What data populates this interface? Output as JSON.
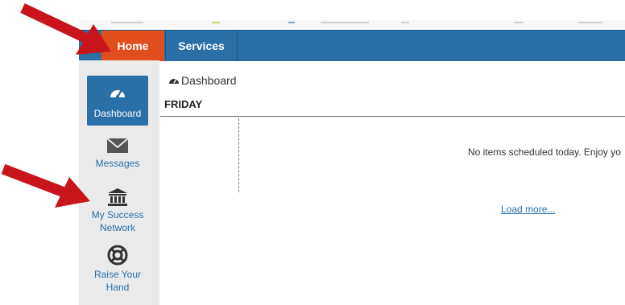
{
  "nav": {
    "home_label": "Home",
    "services_label": "Services"
  },
  "sidebar": {
    "items": [
      {
        "label": "Dashboard",
        "icon": "dashboard-icon",
        "active": true
      },
      {
        "label": "Messages",
        "icon": "envelope-icon"
      },
      {
        "label": "My Success Network",
        "icon": "bank-icon"
      },
      {
        "label": "Raise Your Hand",
        "icon": "lifebuoy-icon"
      }
    ]
  },
  "main": {
    "breadcrumb": "Dashboard",
    "day_heading": "FRIDAY",
    "empty_message": "No items scheduled today. Enjoy yo",
    "load_more": "Load more..."
  },
  "colors": {
    "nav_blue": "#2a6fa6",
    "home_orange": "#e04e1b",
    "sidebar_gray": "#eaeaea",
    "arrow_red": "#c8151b"
  }
}
